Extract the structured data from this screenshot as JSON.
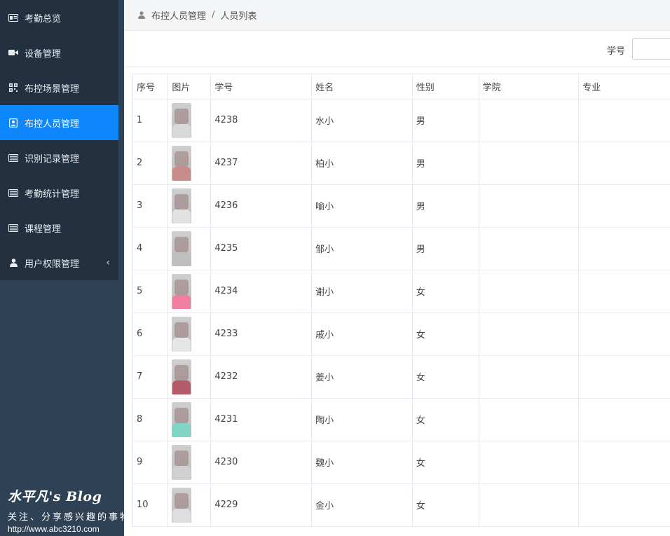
{
  "sidebar": {
    "items": [
      {
        "label": "考勤总览",
        "icon": "id-card-icon"
      },
      {
        "label": "设备管理",
        "icon": "video-camera-icon"
      },
      {
        "label": "布控场景管理",
        "icon": "qrcode-icon"
      },
      {
        "label": "布控人员管理",
        "icon": "person-badge-icon",
        "active": true
      },
      {
        "label": "识别记录管理",
        "icon": "list-icon"
      },
      {
        "label": "考勤统计管理",
        "icon": "list-icon"
      },
      {
        "label": "课程管理",
        "icon": "list-icon"
      },
      {
        "label": "用户权限管理",
        "icon": "user-icon",
        "chevron": "‹"
      }
    ]
  },
  "watermark": {
    "title": "水平凡's Blog",
    "subtitle": "关注、分享感兴趣的事物",
    "url": "http://www.abc3210.com"
  },
  "breadcrumb": {
    "parent": "布控人员管理",
    "separator": "/",
    "current": "人员列表"
  },
  "filter": {
    "label": "学号",
    "value": ""
  },
  "table": {
    "headers": [
      "序号",
      "图片",
      "学号",
      "姓名",
      "性别",
      "学院",
      "专业"
    ],
    "rows": [
      {
        "index": "1",
        "id": "4238",
        "name": "水小",
        "gender": "男",
        "college": "",
        "major": "",
        "tone": "#d9d9d9"
      },
      {
        "index": "2",
        "id": "4237",
        "name": "柏小",
        "gender": "男",
        "college": "",
        "major": "",
        "tone": "#c98a8a"
      },
      {
        "index": "3",
        "id": "4236",
        "name": "喻小",
        "gender": "男",
        "college": "",
        "major": "",
        "tone": "#e2e2e2"
      },
      {
        "index": "4",
        "id": "4235",
        "name": "邹小",
        "gender": "男",
        "college": "",
        "major": "",
        "tone": "#bfbfbf"
      },
      {
        "index": "5",
        "id": "4234",
        "name": "谢小",
        "gender": "女",
        "college": "",
        "major": "",
        "tone": "#ef7ea0"
      },
      {
        "index": "6",
        "id": "4233",
        "name": "戚小",
        "gender": "女",
        "college": "",
        "major": "",
        "tone": "#e6e6e6"
      },
      {
        "index": "7",
        "id": "4232",
        "name": "姜小",
        "gender": "女",
        "college": "",
        "major": "",
        "tone": "#b45a68"
      },
      {
        "index": "8",
        "id": "4231",
        "name": "陶小",
        "gender": "女",
        "college": "",
        "major": "",
        "tone": "#7fd6c4"
      },
      {
        "index": "9",
        "id": "4230",
        "name": "魏小",
        "gender": "女",
        "college": "",
        "major": "",
        "tone": "#d0d0d0"
      },
      {
        "index": "10",
        "id": "4229",
        "name": "金小",
        "gender": "女",
        "college": "",
        "major": "",
        "tone": "#dedede"
      }
    ]
  }
}
